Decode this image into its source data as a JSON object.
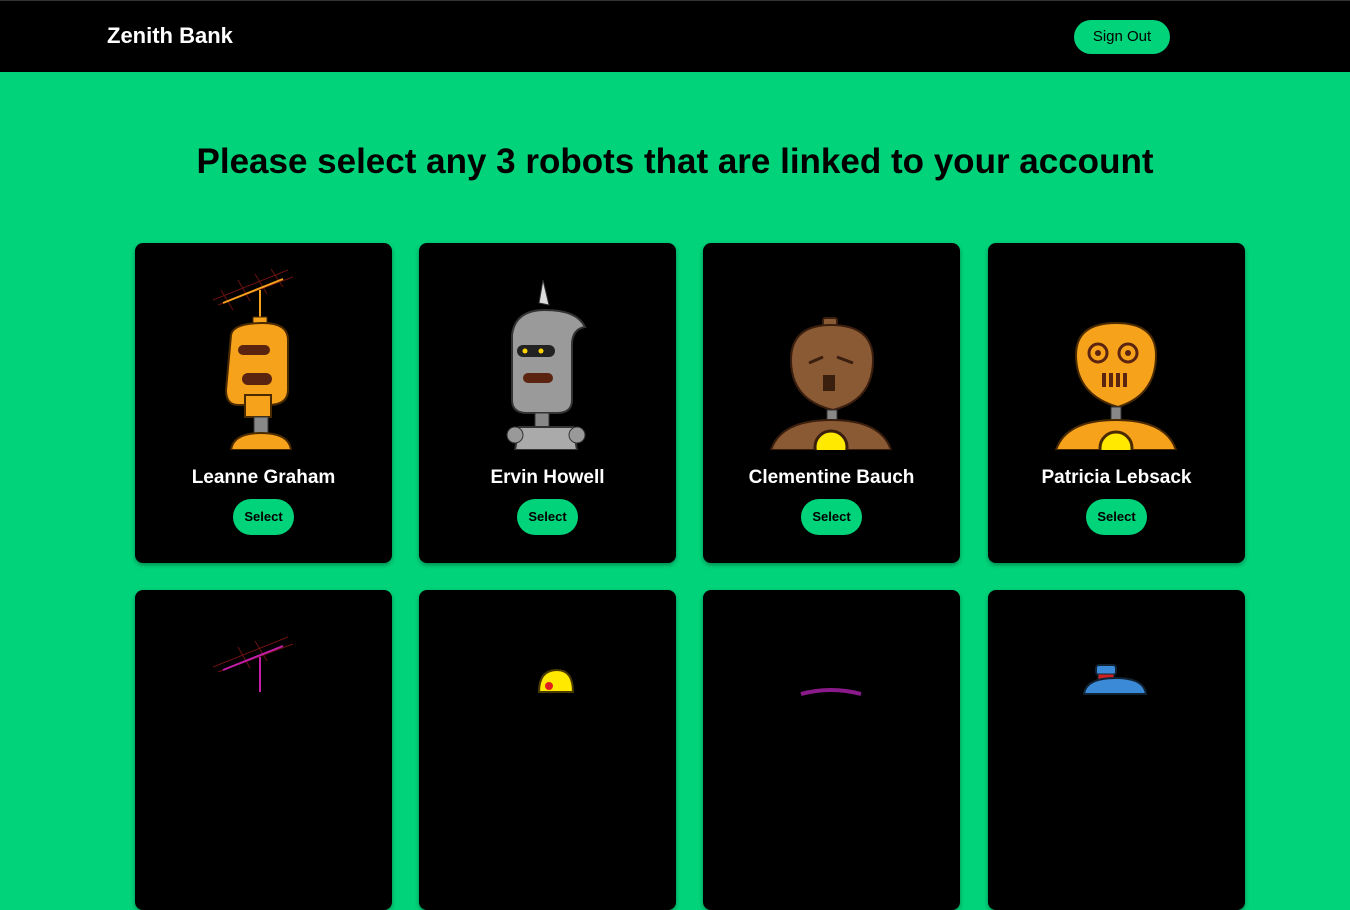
{
  "header": {
    "brand": "Zenith Bank",
    "sign_out_label": "Sign Out"
  },
  "main": {
    "title": "Please select any 3 robots that are linked to your account",
    "select_label": "Select",
    "robots": [
      {
        "name": "Leanne Graham"
      },
      {
        "name": "Ervin Howell"
      },
      {
        "name": "Clementine Bauch"
      },
      {
        "name": "Patricia Lebsack"
      },
      {
        "name": ""
      },
      {
        "name": ""
      },
      {
        "name": ""
      },
      {
        "name": ""
      }
    ]
  },
  "colors": {
    "accent": "#00d37a",
    "card": "#000000",
    "header": "#000000"
  }
}
